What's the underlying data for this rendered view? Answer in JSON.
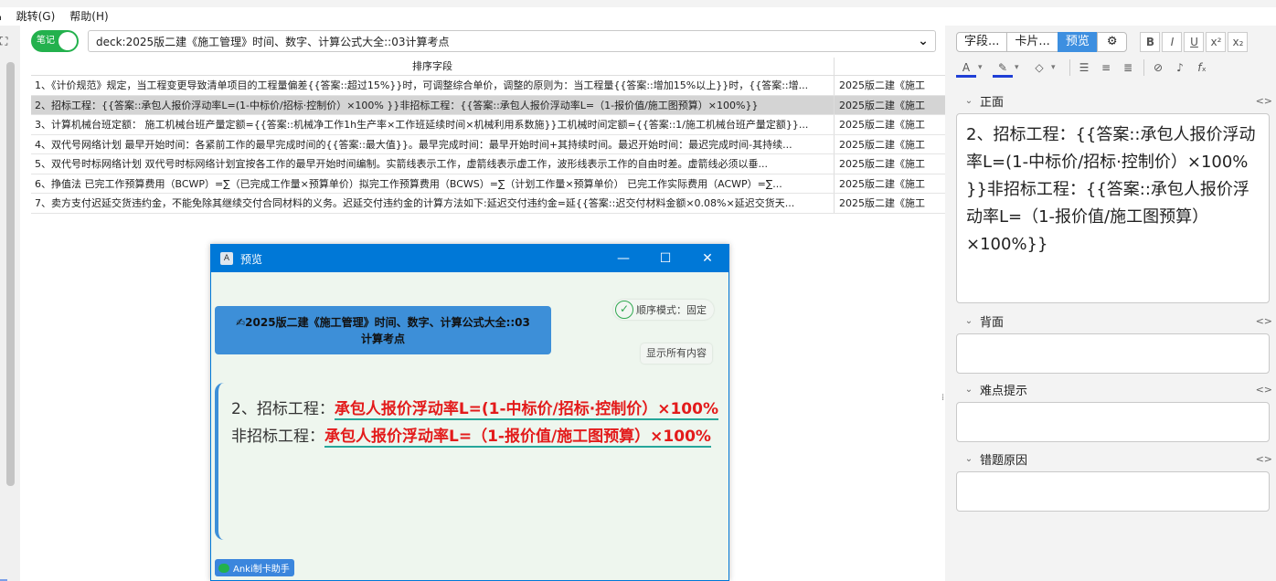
{
  "menu": {
    "items": [
      "⌂",
      "跳转(G)",
      "帮助(H)"
    ]
  },
  "browser": {
    "toggle_label": "笔记",
    "deck_select": "deck:2025版二建《施工管理》时间、数字、计算公式大全::03计算考点",
    "column_sort": "排序字段",
    "rows": [
      {
        "sort": "1、《计价规范》规定，当工程变更导致清单项目的工程量偏差{{答案::超过15%}}时，可调整综合单价，调整的原则为：当工程量{{答案::增加15%以上}}时，{{答案::增...",
        "deck": "2025版二建《施工",
        "selected": false
      },
      {
        "sort": "2、招标工程：{{答案::承包人报价浮动率L=(1-中标价/招标·控制价）×100% }}非招标工程：{{答案::承包人报价浮动率L=（1-报价值/施工图预算）×100%}}",
        "deck": "2025版二建《施工",
        "selected": true
      },
      {
        "sort": "3、计算机械台班定额： 施工机械台班产量定额={{答案::机械净工作1h生产率×工作班延续时间×机械利用系数施}}工机械时间定额={{答案::1/施工机械台班产量定额}}...",
        "deck": "2025版二建《施工",
        "selected": false
      },
      {
        "sort": "4、双代号网络计划 最早开始时间：各紧前工作的最早完成时间的{{答案::最大值}}。最早完成时间：最早开始时间+其持续时间。最迟开始时间：最迟完成时间-其持续...",
        "deck": "2025版二建《施工",
        "selected": false
      },
      {
        "sort": "5、双代号时标网络计划 双代号时标网络计划宜按各工作的最早开始时间编制。实箭线表示工作，虚箭线表示虚工作，波形线表示工作的自由时差。虚箭线必须以垂...",
        "deck": "2025版二建《施工",
        "selected": false
      },
      {
        "sort": "6、挣值法 已完工作预算费用（BCWP）=∑（已完成工作量×预算单价）拟完工作预算费用（BCWS）=∑（计划工作量×预算单价） 已完工作实际费用（ACWP）=∑...",
        "deck": "2025版二建《施工",
        "selected": false
      },
      {
        "sort": "7、卖方支付迟延交货违约金，不能免除其继续交付合同材料的义务。迟延交付违约金的计算方法如下:延迟交付违约金=延{{答案::迟交付材料金额×0.08%×延迟交货天...",
        "deck": "2025版二建《施工",
        "selected": false
      }
    ]
  },
  "preview": {
    "window_title": "预览",
    "order_mode": "顺序模式：固定",
    "deck_banner": "✍2025版二建《施工管理》时间、数字、计算公式大全::03计算考点",
    "show_all": "显示所有内容",
    "card": {
      "part1": "2、招标工程：",
      "cloze1": "承包人报价浮动率L=(1-中标价/招标·控制价）×100%",
      "part2": " 非招标工程：",
      "cloze2": "承包人报价浮动率L=（1-报价值/施工图预算）×100%"
    },
    "helper": "Anki制卡助手"
  },
  "editor": {
    "tabs": [
      "字段...",
      "卡片...",
      "预览"
    ],
    "fields": [
      {
        "name": "正面",
        "value": "2、招标工程：{{答案::承包人报价浮动率L=(1-中标价/招标·控制价）×100% }}非招标工程：{{答案::承包人报价浮动率L=（1-报价值/施工图预算）×100%}}"
      },
      {
        "name": "背面",
        "value": ""
      },
      {
        "name": "难点提示",
        "value": ""
      },
      {
        "name": "错题原因",
        "value": ""
      }
    ],
    "field_code_icon": "<>"
  },
  "colors": {
    "accent": "#0078d7",
    "toggle": "#23b14d",
    "cloze": "#e31b1b",
    "cloze_underline": "#26a69a"
  }
}
